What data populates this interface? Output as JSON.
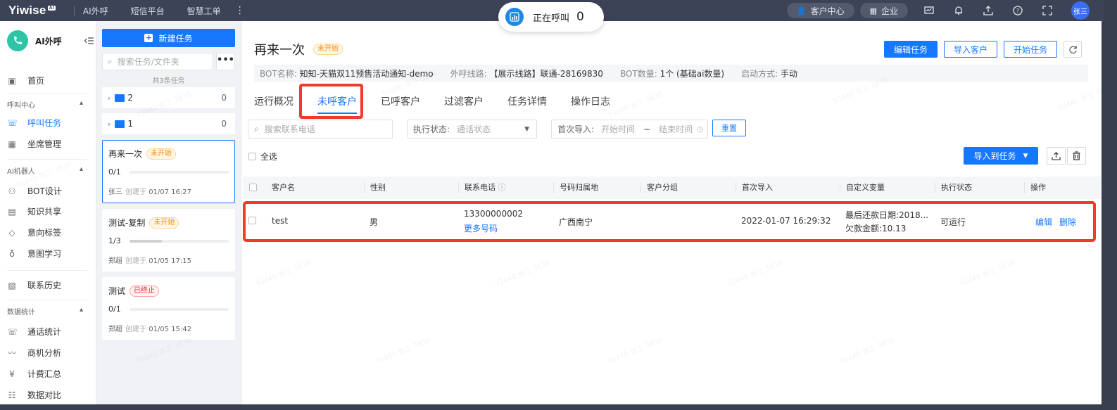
{
  "topbar": {
    "logo": "Yiwise",
    "logo_sup": "AI",
    "nav": [
      "AI外呼",
      "短信平台",
      "智慧工单"
    ],
    "customer_center": "客户中心",
    "enterprise": "企业",
    "avatar": "张三"
  },
  "calling": {
    "label": "正在呼叫",
    "count": "0"
  },
  "sidebar": {
    "title": "AI外呼",
    "home": "首页",
    "group_call": "呼叫中心",
    "call_tasks": "呼叫任务",
    "seat_mgmt": "坐席管理",
    "group_ai": "AI机器人",
    "bot_design": "BOT设计",
    "knowledge": "知识共享",
    "intent_tags": "意向标签",
    "intent_learning": "意图学习",
    "contact_history": "联系历史",
    "group_stats": "数据统计",
    "call_stats": "通话统计",
    "biz_analysis": "商机分析",
    "billing": "计费汇总",
    "data_compare": "数据对比"
  },
  "taskpanel": {
    "new_task": "新建任务",
    "search_placeholder": "搜索任务/文件夹",
    "count_text": "共3条任务",
    "folders": [
      {
        "name": "2",
        "count": "0"
      },
      {
        "name": "1",
        "count": "0"
      }
    ],
    "tasks": [
      {
        "name": "再来一次",
        "status": "未开始",
        "progress": "0/1",
        "progress_fraction": 0.0,
        "owner": "张三",
        "created_label": "创建于",
        "created": "01/07 16:27"
      },
      {
        "name": "测试-复制",
        "status": "未开始",
        "progress": "1/3",
        "progress_fraction": 0.33,
        "owner": "郑超",
        "created_label": "创建于",
        "created": "01/05 17:15"
      },
      {
        "name": "测试",
        "status": "已终止",
        "progress": "0/1",
        "progress_fraction": 0.0,
        "owner": "郑超",
        "created_label": "创建于",
        "created": "01/05 15:42"
      }
    ]
  },
  "main": {
    "title": "再来一次",
    "status": "未开始",
    "buttons": {
      "edit": "编辑任务",
      "import": "导入客户",
      "start": "开始任务"
    },
    "info": {
      "bot_name_label": "BOT名称:",
      "bot_name": "知知-天猫双11预售活动通知-demo",
      "line_label": "外呼线路:",
      "line": "【展示线路】联通-28169830",
      "bot_count_label": "BOT数量:",
      "bot_count": "1个 (基础ai数量)",
      "start_label": "启动方式:",
      "start_mode": "手动"
    },
    "tabs": [
      "运行概况",
      "未呼客户",
      "已呼客户",
      "过滤客户",
      "任务详情",
      "操作日志"
    ],
    "filters": {
      "search_placeholder": "搜索联系电话",
      "exec_label": "执行状态:",
      "exec_placeholder": "通话状态",
      "import_label": "首次导入:",
      "start_placeholder": "开始时间",
      "tilde": "~",
      "end_placeholder": "结束时间",
      "reset": "重置"
    },
    "select_all": "全选",
    "import_to_task": "导入到任务",
    "columns": [
      "客户名",
      "性别",
      "联系电话",
      "号码归属地",
      "客户分组",
      "首次导入",
      "自定义变量",
      "执行状态",
      "操作"
    ],
    "rows": [
      {
        "name": "test",
        "gender": "男",
        "phone": "13300000002",
        "more_phones": "更多号码",
        "location": "广西南宁",
        "group": "",
        "first_import": "2022-01-07 16:29:32",
        "var1": "最后还款日期:2018...",
        "var2": "欠款金额:10.13",
        "exec_status": "可运行",
        "edit": "编辑",
        "delete": "删除"
      }
    ]
  },
  "watermark": "93440 张三 3838",
  "colors": {
    "primary": "#1677ff",
    "topbar": "#3d4357",
    "highlight": "#f03a2e",
    "badge_orange": "#fa8c16",
    "badge_red": "#f5222d"
  }
}
